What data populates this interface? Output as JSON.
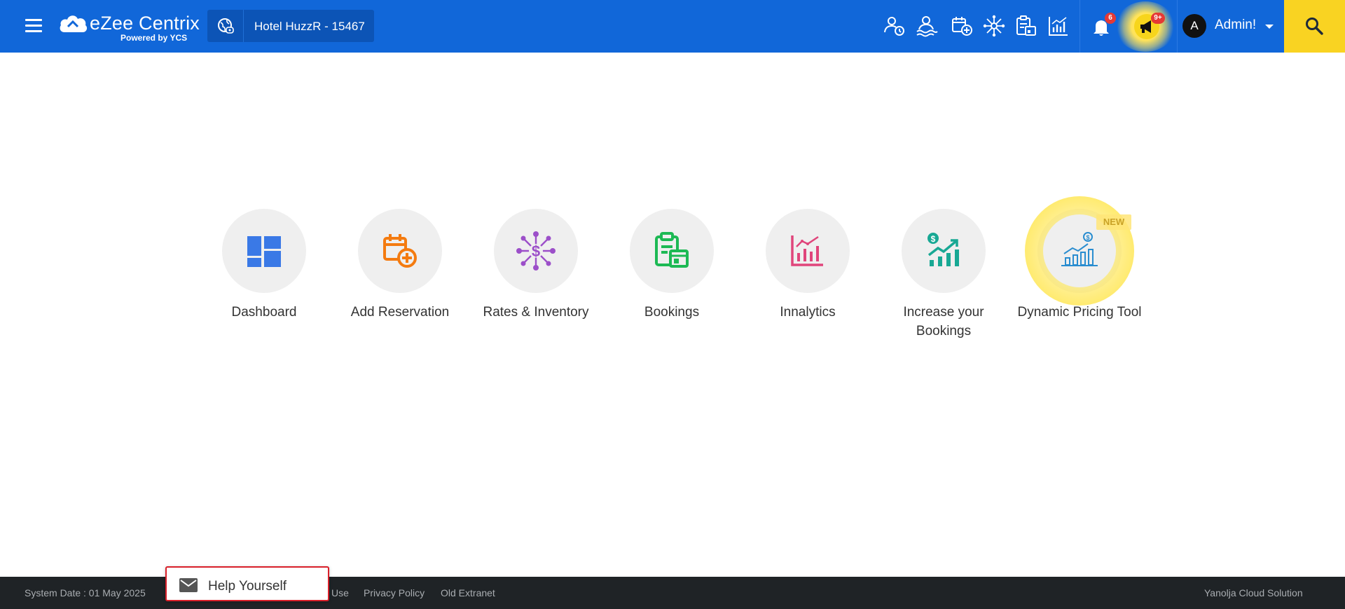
{
  "brand": {
    "name": "eZee Centrix",
    "sub": "Powered by YCS"
  },
  "hotel": {
    "name": "Hotel HuzzR - ",
    "id": "15467"
  },
  "header": {
    "notification_count": "6",
    "announcement_count": "9+",
    "user_initial": "A",
    "user_name": "Admin!"
  },
  "tiles": [
    {
      "label": "Dashboard",
      "icon": "dashboard-icon",
      "color": "#3a79e6"
    },
    {
      "label": "Add Reservation",
      "icon": "calendar-add-icon",
      "color": "#f47b10"
    },
    {
      "label": "Rates & Inventory",
      "icon": "rates-network-icon",
      "color": "#9c4fc9"
    },
    {
      "label": "Bookings",
      "icon": "bookings-clipboard-icon",
      "color": "#1db954"
    },
    {
      "label": "Innalytics",
      "icon": "analytics-chart-icon",
      "color": "#e0457b"
    },
    {
      "label": "Increase your Bookings",
      "icon": "growth-dollar-icon",
      "color": "#18a894"
    },
    {
      "label": "Dynamic Pricing Tool",
      "icon": "pricing-chart-icon",
      "color": "#2a8dd0",
      "badge": "NEW"
    }
  ],
  "footer": {
    "system_date": "System Date : 01 May 2025",
    "terms_tail": "Use",
    "privacy": "Privacy Policy",
    "old_extranet": "Old Extranet",
    "company": "Yanolja Cloud Solution"
  },
  "help": {
    "label": "Help Yourself"
  },
  "colors": {
    "header": "#1167d9",
    "search_button": "#f9d322",
    "footer": "#1f2326"
  }
}
